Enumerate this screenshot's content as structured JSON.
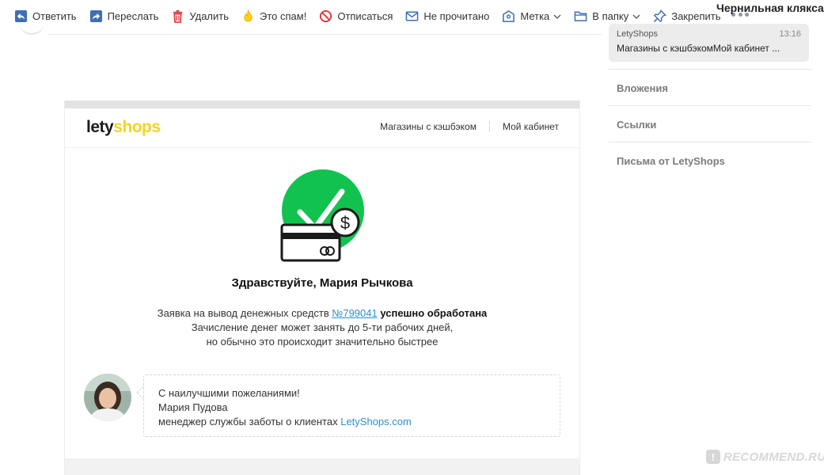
{
  "toolbar": {
    "reply": "Ответить",
    "forward": "Переслать",
    "delete": "Удалить",
    "spam": "Это спам!",
    "unsubscribe": "Отписаться",
    "unread": "Не прочитано",
    "label": "Метка",
    "to_folder": "В папку",
    "pin": "Закрепить"
  },
  "folder_title": "Чернильная клякса",
  "thread": {
    "sender": "LetyShops",
    "time": "13:16",
    "subject": "Магазины с кэшбэкомМой кабинет ..."
  },
  "side_links": {
    "attachments": "Вложения",
    "links": "Ссылки",
    "from_sender": "Письма от LetyShops"
  },
  "email": {
    "logo_part1": "lety",
    "logo_part2": "shops",
    "nav_shops": "Магазины с кэшбэком",
    "nav_cabinet": "Мой кабинет",
    "greeting": "Здравствуйте, Мария Рычкова",
    "line1_prefix": "Заявка на вывод денежных средств",
    "request_number": "№799041",
    "line1_suffix": "успешно обработана",
    "line2": "Зачисление денег может занять до 5-ти рабочих дней,",
    "line3": "но обычно это происходит значительно быстрее",
    "sig_regards": "С наилучшими пожеланиями!",
    "sig_name": "Мария Пудова",
    "sig_role": "менеджер службы заботы о клиентах",
    "sig_link": "LetyShops.com"
  },
  "watermark": "RECOMMEND.RU",
  "colors": {
    "accent_blue": "#2a8fd0",
    "toolbar_icon_blue": "#3e6fb3",
    "delete_red": "#e0383a",
    "logo_yellow": "#f6d31d",
    "hero_green": "#12c24f"
  }
}
